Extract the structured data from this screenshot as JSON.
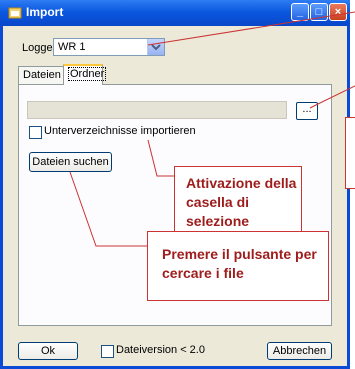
{
  "window": {
    "title": "Import"
  },
  "logger": {
    "label": "Logger:",
    "value": "WR 1"
  },
  "tabs": [
    {
      "label": "Dateien"
    },
    {
      "label": "Ordner"
    }
  ],
  "folder": {
    "browse_label": "...",
    "subdirs_label": "Unterverzeichnisse importieren",
    "search_label": "Dateien suchen"
  },
  "footer": {
    "ok_label": "Ok",
    "version_label": "Dateiversion < 2.0",
    "cancel_label": "Abbrechen"
  },
  "callouts": {
    "checkbox": "Attivazione della casella di selezione",
    "search": "Premere il pulsante per cercare i file"
  },
  "colors": {
    "callout_border": "#cc3333",
    "callout_text": "#9e1c1c",
    "titlebar": "#0b58e0"
  }
}
